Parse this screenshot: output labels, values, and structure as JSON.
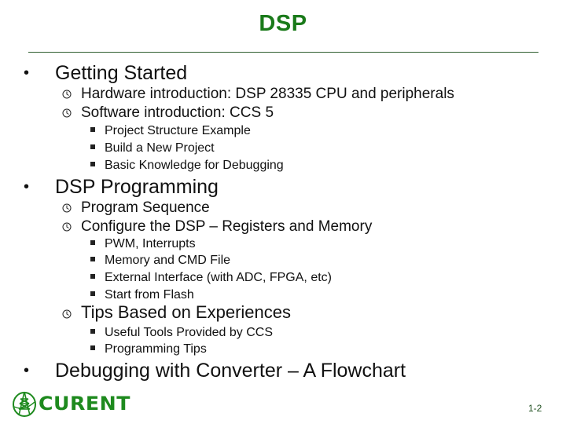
{
  "slide": {
    "title": "DSP",
    "page_number": "1-2",
    "brand_color": "#1a7a1a",
    "logo": {
      "icon": "transmission-tower-globe-icon",
      "text": "CURENT"
    }
  },
  "outline": [
    {
      "label": "Getting Started",
      "bullet": "•",
      "children": [
        {
          "label": "Hardware introduction: DSP 28335 CPU and peripherals",
          "bullet_icon": "clock-icon"
        },
        {
          "label": "Software introduction: CCS 5",
          "bullet_icon": "clock-icon",
          "children": [
            {
              "label": "Project Structure Example",
              "bullet_icon": "square-bullet-icon"
            },
            {
              "label": "Build a New Project",
              "bullet_icon": "square-bullet-icon"
            },
            {
              "label": "Basic Knowledge for Debugging",
              "bullet_icon": "square-bullet-icon"
            }
          ]
        }
      ]
    },
    {
      "label": "DSP Programming",
      "bullet": "•",
      "children": [
        {
          "label": "Program Sequence",
          "bullet_icon": "clock-icon"
        },
        {
          "label": "Configure the DSP – Registers and Memory",
          "bullet_icon": "clock-icon",
          "children": [
            {
              "label": "PWM, Interrupts",
              "bullet_icon": "square-bullet-icon"
            },
            {
              "label": "Memory and CMD File",
              "bullet_icon": "square-bullet-icon"
            },
            {
              "label": "External Interface (with ADC, FPGA, etc)",
              "bullet_icon": "square-bullet-icon"
            },
            {
              "label": "Start from Flash",
              "bullet_icon": "square-bullet-icon"
            }
          ]
        },
        {
          "label": "Tips Based on Experiences",
          "bullet_icon": "clock-icon",
          "children": [
            {
              "label": "Useful Tools Provided by CCS",
              "bullet_icon": "square-bullet-icon"
            },
            {
              "label": "Programming Tips",
              "bullet_icon": "square-bullet-icon"
            }
          ]
        }
      ]
    },
    {
      "label": "Debugging with Converter – A Flowchart",
      "bullet": "•"
    }
  ]
}
